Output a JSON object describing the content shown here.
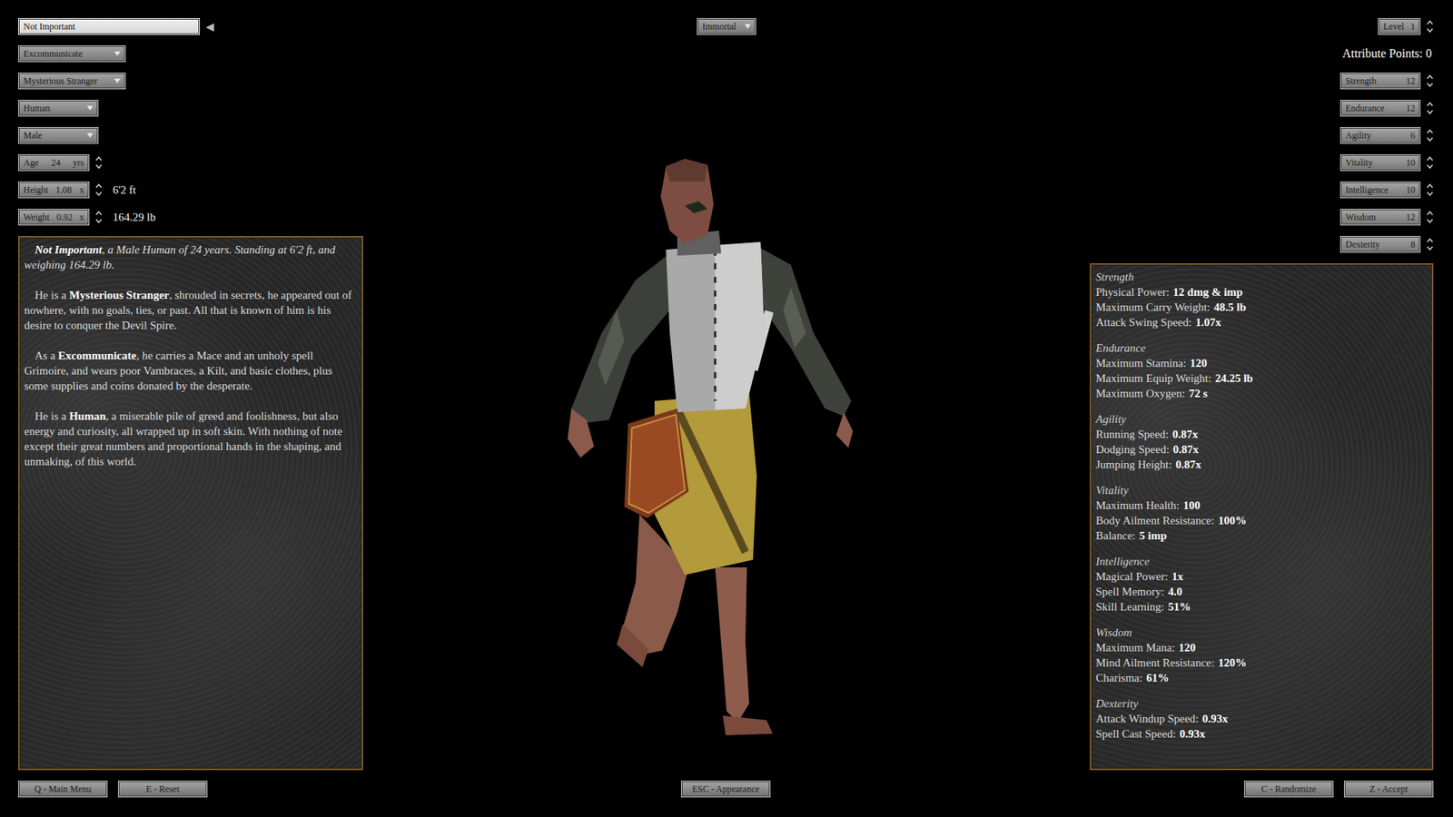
{
  "identity": {
    "name": "Not Important",
    "name_arrow": "◀",
    "class": "Excommunicate",
    "background": "Mysterious Stranger",
    "race": "Human",
    "sex": "Male"
  },
  "difficulty": "Immortal",
  "body": [
    {
      "label": "Age",
      "value": "24",
      "unit": "yrs",
      "readout": ""
    },
    {
      "label": "Height",
      "value": "1.08",
      "unit": "x",
      "readout": "6'2 ft"
    },
    {
      "label": "Weight",
      "value": "0.92",
      "unit": "x",
      "readout": "164.29 lb"
    }
  ],
  "description": [
    [
      {
        "text": "Not Important",
        "bold": true,
        "italic": true
      },
      {
        "text": ", a Male Human of 24 years. Standing at 6'2 ft, and weighing 164.29 lb.",
        "bold": false,
        "italic": true
      }
    ],
    [
      {
        "text": "He is a ",
        "bold": false,
        "italic": false
      },
      {
        "text": "Mysterious Stranger",
        "bold": true,
        "italic": false
      },
      {
        "text": ", shrouded in secrets, he appeared out of nowhere, with no goals, ties, or past. All that is known of him is his desire to conquer the Devil Spire.",
        "bold": false,
        "italic": false
      }
    ],
    [
      {
        "text": "As a ",
        "bold": false,
        "italic": false
      },
      {
        "text": "Excommunicate",
        "bold": true,
        "italic": false
      },
      {
        "text": ", he carries a Mace and an unholy spell Grimoire, and wears poor Vambraces, a Kilt, and basic clothes, plus some supplies and coins donated by the desperate.",
        "bold": false,
        "italic": false
      }
    ],
    [
      {
        "text": "He is a ",
        "bold": false,
        "italic": false
      },
      {
        "text": "Human",
        "bold": true,
        "italic": false
      },
      {
        "text": ", a miserable pile of greed and foolishness, but also energy and curiosity, all wrapped up in soft skin. With nothing of note except their great numbers and proportional hands in the shaping, and unmaking, of this world.",
        "bold": false,
        "italic": false
      }
    ]
  ],
  "level": {
    "label": "Level",
    "value": "1"
  },
  "attribute_points": "Attribute Points: 0",
  "attributes": [
    {
      "label": "Strength",
      "value": "12"
    },
    {
      "label": "Endurance",
      "value": "12"
    },
    {
      "label": "Agility",
      "value": "6"
    },
    {
      "label": "Vitality",
      "value": "10"
    },
    {
      "label": "Intelligence",
      "value": "10"
    },
    {
      "label": "Wisdom",
      "value": "12"
    },
    {
      "label": "Dexterity",
      "value": "8"
    }
  ],
  "stats": [
    {
      "title": "Strength",
      "lines": [
        {
          "label": "Physical Power:",
          "value": "12 dmg & imp"
        },
        {
          "label": "Maximum Carry Weight:",
          "value": "48.5 lb"
        },
        {
          "label": "Attack Swing Speed:",
          "value": "1.07x"
        }
      ]
    },
    {
      "title": "Endurance",
      "lines": [
        {
          "label": "Maximum Stamina:",
          "value": "120"
        },
        {
          "label": "Maximum Equip Weight:",
          "value": "24.25 lb"
        },
        {
          "label": "Maximum Oxygen:",
          "value": "72 s"
        }
      ]
    },
    {
      "title": "Agility",
      "lines": [
        {
          "label": "Running Speed:",
          "value": "0.87x"
        },
        {
          "label": "Dodging Speed:",
          "value": "0.87x"
        },
        {
          "label": "Jumping Height:",
          "value": "0.87x"
        }
      ]
    },
    {
      "title": "Vitality",
      "lines": [
        {
          "label": "Maximum Health:",
          "value": "100"
        },
        {
          "label": "Body Ailment Resistance:",
          "value": "100%"
        },
        {
          "label": "Balance:",
          "value": "5 imp"
        }
      ]
    },
    {
      "title": "Intelligence",
      "lines": [
        {
          "label": "Magical Power:",
          "value": "1x"
        },
        {
          "label": "Spell Memory:",
          "value": "4.0"
        },
        {
          "label": "Skill Learning:",
          "value": "51%"
        }
      ]
    },
    {
      "title": "Wisdom",
      "lines": [
        {
          "label": "Maximum Mana:",
          "value": "120"
        },
        {
          "label": "Mind Ailment Resistance:",
          "value": "120%"
        },
        {
          "label": "Charisma:",
          "value": "61%"
        }
      ]
    },
    {
      "title": "Dexterity",
      "lines": [
        {
          "label": "Attack Windup Speed:",
          "value": "0.93x"
        },
        {
          "label": "Spell Cast Speed:",
          "value": "0.93x"
        }
      ]
    }
  ],
  "buttons_left": [
    "Q - Main Menu",
    "E - Reset"
  ],
  "buttons_center": [
    "ESC - Appearance"
  ],
  "buttons_right": [
    "C - Randomize",
    "Z - Accept"
  ]
}
